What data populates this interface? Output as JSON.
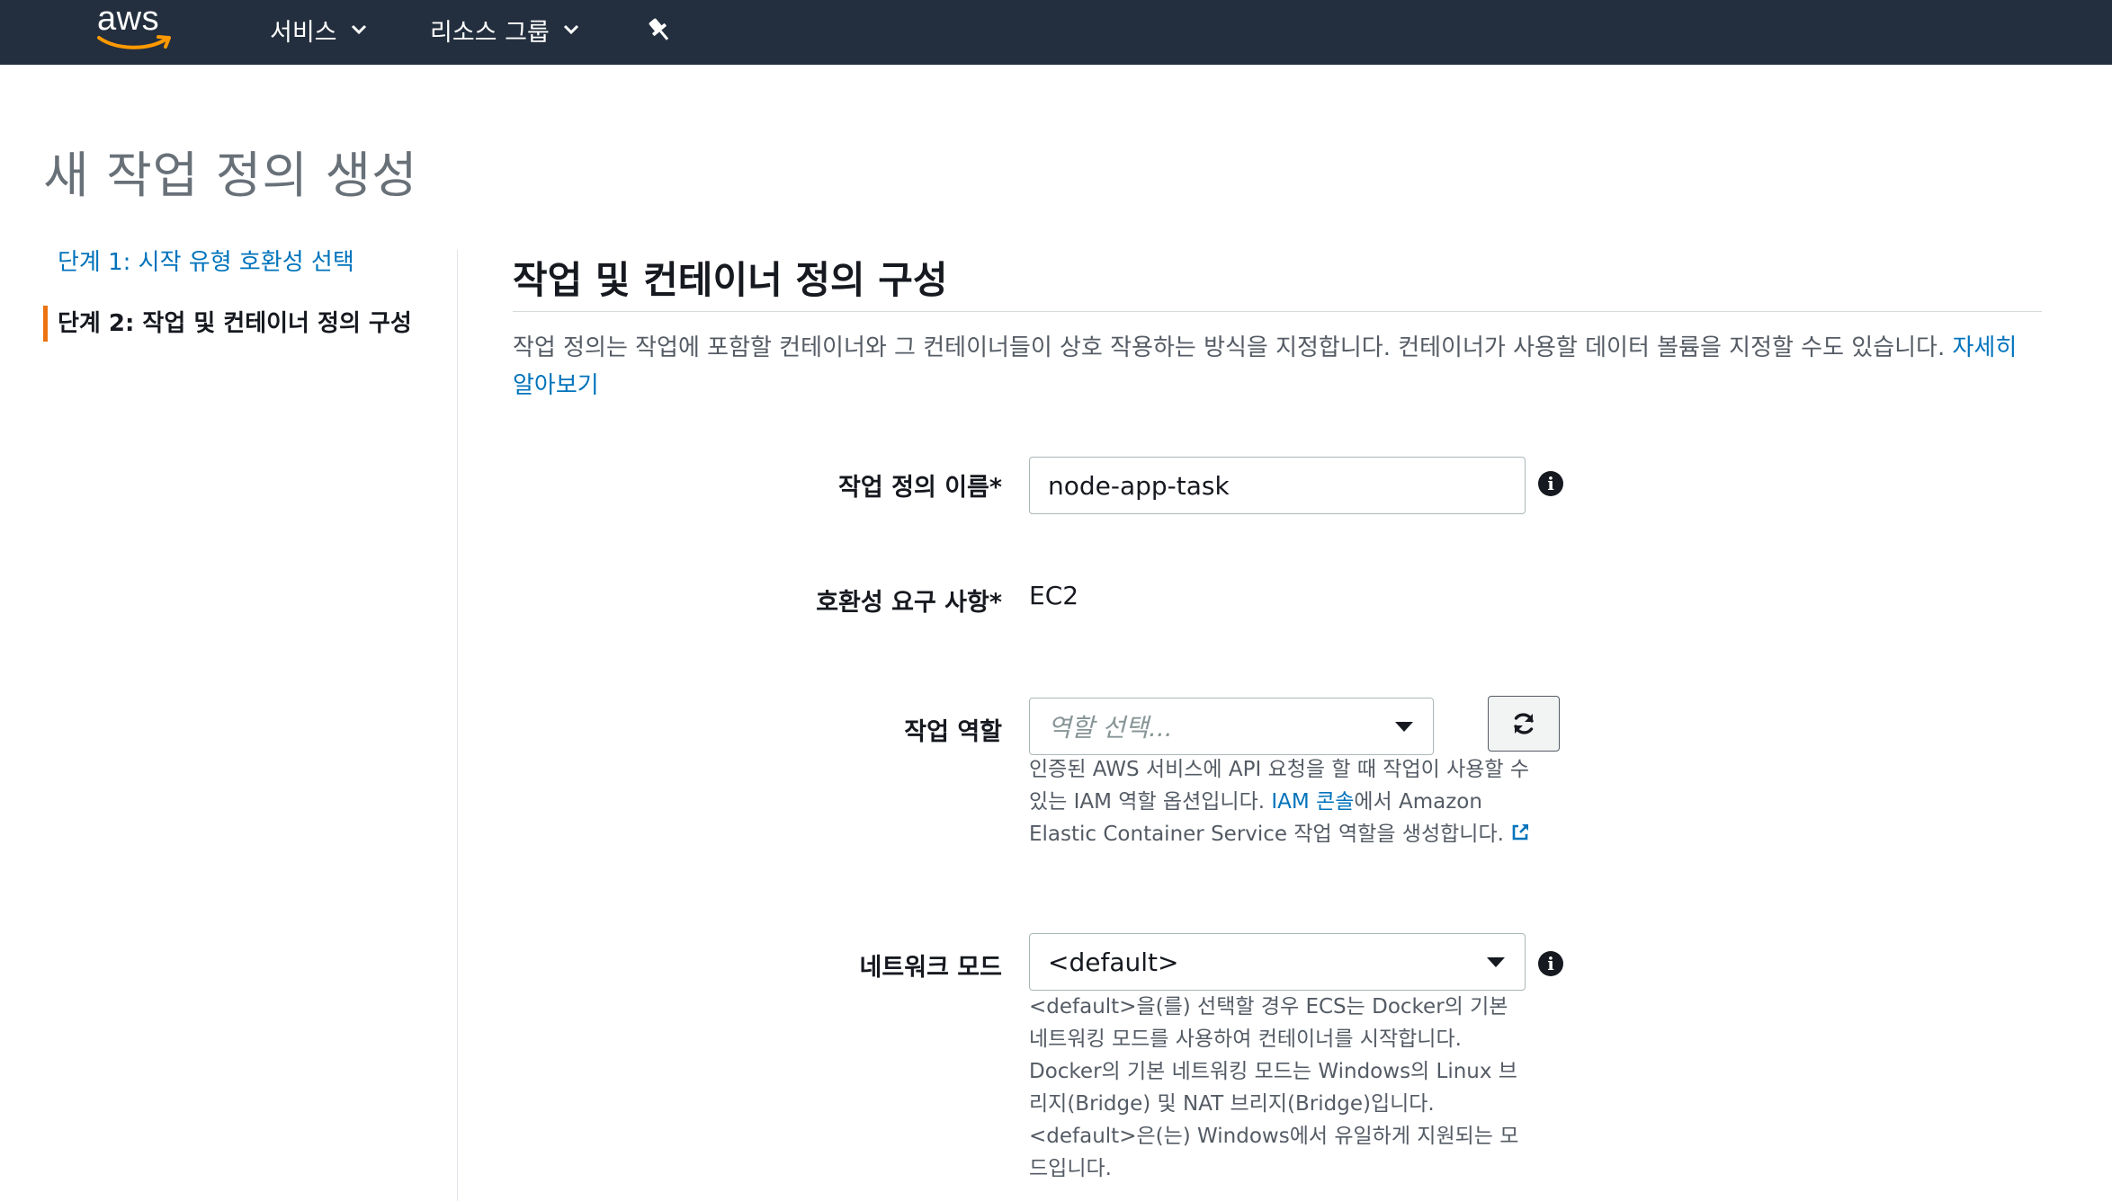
{
  "brand": {
    "logo_text": "aws"
  },
  "topnav": {
    "services_label": "서비스",
    "resource_groups_label": "리소스 그룹"
  },
  "page": {
    "title": "새 작업 정의 생성"
  },
  "steps": [
    {
      "label": "단계 1: 시작 유형 호환성 선택"
    },
    {
      "label": "단계 2: 작업 및 컨테이너 정의 구성"
    }
  ],
  "section": {
    "title": "작업 및 컨테이너 정의 구성",
    "description": "작업 정의는 작업에 포함할 컨테이너와 그 컨테이너들이 상호 작용하는 방식을 지정합니다. 컨테이너가 사용할 데이터 볼륨을 지정할 수도 있습니다. ",
    "learn_more": "자세히 알아보기"
  },
  "form": {
    "task_definition_name": {
      "label": "작업 정의 이름*",
      "value": "node-app-task"
    },
    "compatibility": {
      "label": "호환성 요구 사항*",
      "value": "EC2"
    },
    "task_role": {
      "label": "작업 역할",
      "placeholder": "역할 선택...",
      "help_prefix": "인증된 AWS 서비스에 API 요청을 할 때 작업이 사용할 수 있는 IAM 역할 옵션입니다. ",
      "help_link": "IAM 콘솔",
      "help_suffix": "에서 Amazon Elastic Container Service 작업 역할을 생성합니다."
    },
    "network_mode": {
      "label": "네트워크 모드",
      "value": "<default>",
      "help": "<default>을(를) 선택할 경우 ECS는 Docker의 기본 네트워킹 모드를 사용하여 컨테이너를 시작합니다. Docker의 기본 네트워킹 모드는 Windows의 Linux 브리지(Bridge) 및 NAT 브리지(Bridge)입니다. <default>은(는) Windows에서 유일하게 지원되는 모드입니다."
    }
  },
  "colors": {
    "nav_bg": "#232f3e",
    "link": "#0073bb",
    "active_step_accent": "#ec7211",
    "aws_smile": "#ff9900"
  },
  "icons": [
    "chevron-down-icon",
    "pin-icon",
    "info-icon",
    "caret-down-icon",
    "refresh-icon",
    "external-link-icon"
  ]
}
